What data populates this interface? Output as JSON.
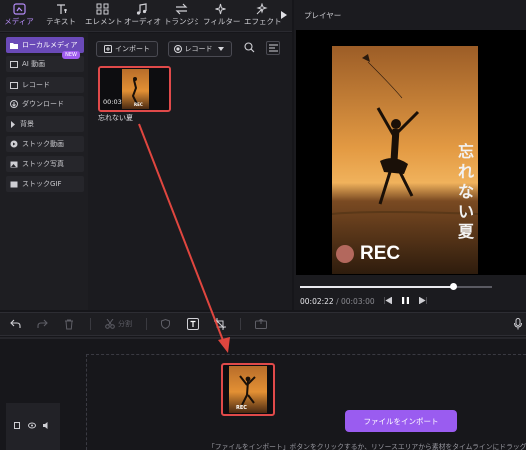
{
  "tabs": [
    {
      "label": "メディア",
      "icon": "media-icon"
    },
    {
      "label": "テキスト",
      "icon": "text-icon"
    },
    {
      "label": "エレメント",
      "icon": "element-icon"
    },
    {
      "label": "オーディオ",
      "icon": "audio-icon"
    },
    {
      "label": "トランジション",
      "icon": "transition-icon"
    },
    {
      "label": "フィルター",
      "icon": "filter-icon"
    },
    {
      "label": "エフェクト",
      "icon": "effect-icon"
    }
  ],
  "sidebar": {
    "items": [
      {
        "label": "ローカルメディア",
        "icon": "folder-icon"
      },
      {
        "label": "AI 動画",
        "icon": "ai-video-icon",
        "badge": "NEW"
      },
      {
        "label": "レコード",
        "icon": "record-icon"
      },
      {
        "label": "ダウンロード",
        "icon": "download-icon"
      },
      {
        "label": "背景",
        "icon": "background-icon"
      },
      {
        "label": "ストック動画",
        "icon": "stock-video-icon"
      },
      {
        "label": "ストック写真",
        "icon": "stock-photo-icon"
      },
      {
        "label": "ストックGIF",
        "icon": "stock-gif-icon"
      }
    ]
  },
  "media": {
    "import_label": "インポート",
    "record_label": "レコード",
    "clip": {
      "name": "忘れない夏",
      "duration": "00:03",
      "thumb_caption": "REC"
    }
  },
  "player": {
    "title": "プレイヤー",
    "overlay_text": "忘れない夏",
    "rec_label": "REC",
    "current_time": "00:02:22",
    "total_time": "00:03:00",
    "progress": 0.8
  },
  "timeline": {
    "split_label": "分割",
    "import_button": "ファイルをインポート",
    "hint_text": "「ファイルをインポート」ボタンをクリックするか、リソースエリアから素材をタイムラインにドラッグ"
  },
  "colors": {
    "accent": "#9a5cf0",
    "arrow": "#e0463f",
    "highlight": "#e04a4a"
  }
}
